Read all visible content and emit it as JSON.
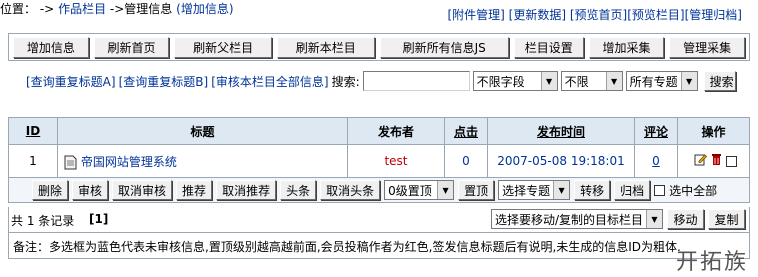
{
  "breadcrumb": {
    "prefix": "位置：",
    "arrow1": "->",
    "link1": "作品栏目",
    "arrow2": "->",
    "current": "管理信息",
    "add_link": "(增加信息)"
  },
  "top_links": [
    "[附件管理]",
    "[更新数据]",
    "[预览首页]",
    "[预览栏目]",
    "[管理归档]"
  ],
  "toolbar": [
    "增加信息",
    "刷新首页",
    "刷新父栏目",
    "刷新本栏目",
    "刷新所有信息JS",
    "栏目设置",
    "增加采集",
    "管理采集"
  ],
  "search": {
    "link1": "[查询重复标题A]",
    "link2": "[查询重复标题B]",
    "link3": "[审核本栏目全部信息]",
    "label": "搜索:",
    "input_value": "",
    "field_select": "不限字段",
    "scope_select": "不限",
    "topic_select": "所有专题",
    "button": "搜索"
  },
  "table": {
    "headers": {
      "id": "ID",
      "title": "标题",
      "publisher": "发布者",
      "clicks": "点击",
      "time": "发布时间",
      "comments": "评论",
      "ops": "操作"
    },
    "rows": [
      {
        "id": "1",
        "title": "帝国网站管理系统",
        "publisher": "test",
        "clicks": "0",
        "time": "2007-05-08 19:18:01",
        "comments": "0"
      }
    ]
  },
  "actions": {
    "buttons": [
      "删除",
      "审核",
      "取消审核",
      "推荐",
      "取消推荐",
      "头条",
      "取消头条"
    ],
    "level_select": "0级置顶",
    "top_button": "置顶",
    "topic_select": "选择专题",
    "transfer_button": "转移",
    "archive_button": "归档",
    "select_all": "选中全部"
  },
  "footer": {
    "count_text": "共 1 条记录",
    "page": "[1]",
    "target_select": "选择要移动/复制的目标栏目",
    "move_button": "移动",
    "copy_button": "复制"
  },
  "note": "备注：多选框为蓝色代表未审核信息,置顶级别越高越前面,会员投稿作者为红色,签发信息标题后有说明,未生成的信息ID为粗体.",
  "watermark": "开拓族"
}
